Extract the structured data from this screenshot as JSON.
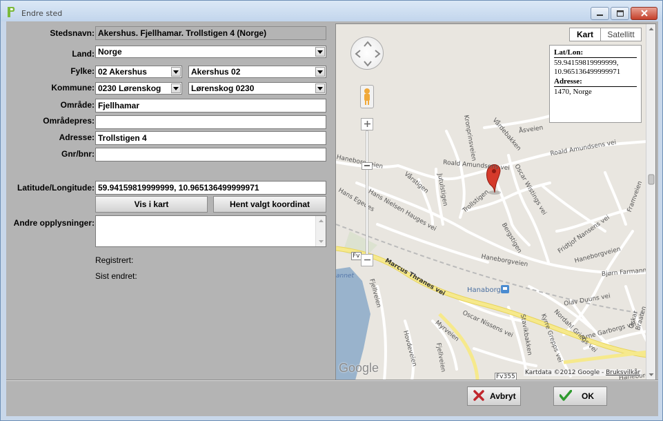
{
  "window": {
    "title": "Endre sted"
  },
  "form": {
    "stedsnavn_label": "Stedsnavn:",
    "stedsnavn_value": "Akershus. Fjellhamar. Trollstigen 4 (Norge)",
    "land_label": "Land:",
    "land_value": "Norge",
    "fylke_label": "Fylke:",
    "fylke_code": "02  Akershus",
    "fylke_name": "Akershus  02",
    "kommune_label": "Kommune:",
    "kommune_code": "0230  Lørenskog",
    "kommune_name": "Lørenskog  0230",
    "omrade_label": "Område:",
    "omrade_value": "Fjellhamar",
    "omradepres_label": "Områdepres:",
    "omradepres_value": "",
    "adresse_label": "Adresse:",
    "adresse_value": "Trollstigen 4",
    "gnr_label": "Gnr/bnr:",
    "gnr_value": "",
    "latlon_label": "Latitude/Longitude:",
    "latlon_value": "59.94159819999999, 10.965136499999971",
    "vis_i_kart": "Vis i kart",
    "hent_koordinat": "Hent valgt koordinat",
    "andre_label": "Andre opplysninger:",
    "andre_value": "",
    "registrert_label": "Registrert:",
    "sist_endret_label": "Sist endret:"
  },
  "map": {
    "type_kart": "Kart",
    "type_satellitt": "Satellitt",
    "info": {
      "latlon_heading": "Lat/Lon:",
      "lat": "59.94159819999999,",
      "lon": "10.965136499999971",
      "adresse_heading": "Adresse:",
      "adresse": "1470, Norge"
    },
    "streets": [
      "Åsveien",
      "Vårdebakken",
      "Roald Amundsens vei",
      "Roald Amundsens vei",
      "Oscar Wistings vei",
      "Kronprinsveien",
      "Jutulstigen",
      "Vårstigen",
      "Haneborgveien",
      "Hans Nielsen Hauges vei",
      "Trollstigen",
      "Bergstigen",
      "Fridtjof Nansens vei",
      "Haneborgveien",
      "Haneborgveien",
      "Bjørn Farmann",
      "Marcus Thranes vei",
      "Olav Duuns vei",
      "Fjellveien",
      "Hanaborg",
      "Oscar Nissens vei",
      "Nordahl Griegs vei",
      "Myrveien",
      "Stavikbakken",
      "Kyrre Grepps vei",
      "Arne Garborgs vei",
      "Hovdeveien",
      "Fjellveien",
      "Framveien",
      "Oskar Braaten",
      "Haneborgveien",
      "Fv355",
      "Fv",
      "Hans Egedes"
    ],
    "lake_label": "annet",
    "google_logo": "Google",
    "attribution": "Kartdata ©2012 Google - ",
    "terms_link": "Bruksvilkår"
  },
  "buttons": {
    "cancel": "Avbryt",
    "ok": "OK"
  },
  "colors": {
    "accent_close": "#c5402a",
    "map_bg": "#e9e6e0",
    "marker": "#d53a2b",
    "major_road": "#f6e98c"
  }
}
